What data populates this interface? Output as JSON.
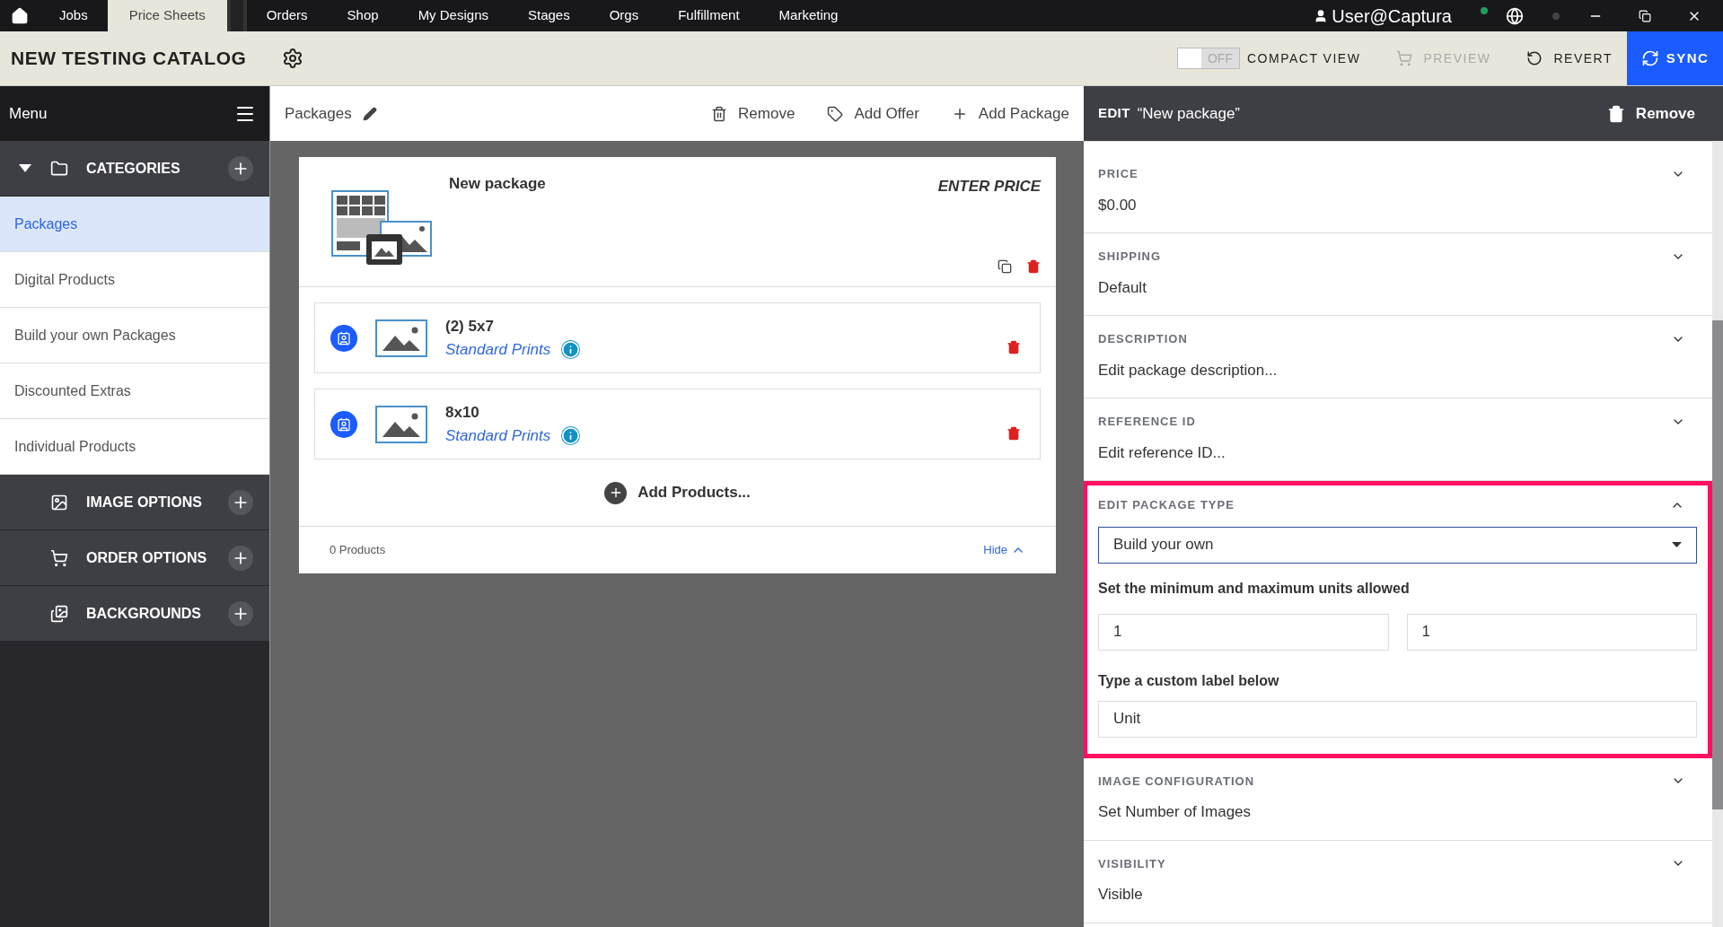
{
  "nav": {
    "tabs": [
      {
        "label": "Jobs",
        "selected": false
      },
      {
        "label": "Price Sheets",
        "selected": true
      },
      {
        "label": "Orders",
        "selected": false
      },
      {
        "label": "Shop",
        "selected": false
      },
      {
        "label": "My Designs",
        "selected": false
      },
      {
        "label": "Stages",
        "selected": false
      },
      {
        "label": "Orgs",
        "selected": false
      },
      {
        "label": "Fulfillment",
        "selected": false
      },
      {
        "label": "Marketing",
        "selected": false
      }
    ],
    "user": "User@Captura"
  },
  "header": {
    "title": "NEW TESTING CATALOG",
    "compact_view": {
      "label": "COMPACT VIEW",
      "on": false,
      "state_text": "OFF"
    },
    "actions": [
      {
        "label": "PREVIEW",
        "kind": "cart",
        "disabled": true
      },
      {
        "label": "REVERT",
        "kind": "revert",
        "disabled": false
      },
      {
        "label": "SYNC",
        "kind": "sync",
        "disabled": false
      }
    ]
  },
  "sidebar": {
    "title": "Menu",
    "groups": [
      {
        "label": "CATEGORIES",
        "kind": "folder",
        "expanded": true,
        "items": [
          {
            "label": "Packages",
            "selected": true
          },
          {
            "label": "Digital Products",
            "selected": false
          },
          {
            "label": "Build your own Packages",
            "selected": false
          },
          {
            "label": "Discounted Extras",
            "selected": false
          },
          {
            "label": "Individual Products",
            "selected": false
          }
        ]
      },
      {
        "label": "IMAGE OPTIONS",
        "kind": "image",
        "expanded": false
      },
      {
        "label": "ORDER OPTIONS",
        "kind": "cart",
        "expanded": false
      },
      {
        "label": "BACKGROUNDS",
        "kind": "backgrounds",
        "expanded": false
      }
    ]
  },
  "toolbar": {
    "title": "Packages",
    "actions": [
      {
        "label": "Remove",
        "kind": "trash"
      },
      {
        "label": "Add Offer",
        "kind": "tag"
      },
      {
        "label": "Add Package",
        "kind": "plus"
      }
    ]
  },
  "package": {
    "name": "New package",
    "price": "ENTER PRICE",
    "products": [
      {
        "name": "(2) 5x7",
        "category": "Standard Prints"
      },
      {
        "name": "8x10",
        "category": "Standard Prints"
      }
    ],
    "add_label": "Add Products...",
    "count": "0 Products",
    "hide": "Hide"
  },
  "editor": {
    "prefix": "EDIT",
    "title": "“New package”",
    "remove": "Remove",
    "sections": [
      {
        "label": "PRICE",
        "value": "$0.00",
        "expanded": false
      },
      {
        "label": "SHIPPING",
        "value": "Default",
        "expanded": false
      },
      {
        "label": "DESCRIPTION",
        "value": "Edit package description...",
        "expanded": false
      },
      {
        "label": "REFERENCE ID",
        "value": "Edit reference ID...",
        "expanded": false
      },
      {
        "label": "EDIT PACKAGE TYPE",
        "expanded": true,
        "type": "Build your own",
        "units_label": "Set the minimum and maximum units allowed",
        "min": "1",
        "max": "1",
        "custom_label_title": "Type a custom label below",
        "custom_label": "Unit"
      },
      {
        "label": "IMAGE CONFIGURATION",
        "value": "Set Number of Images",
        "expanded": false
      },
      {
        "label": "VISIBILITY",
        "value": "Visible",
        "expanded": false
      }
    ]
  }
}
